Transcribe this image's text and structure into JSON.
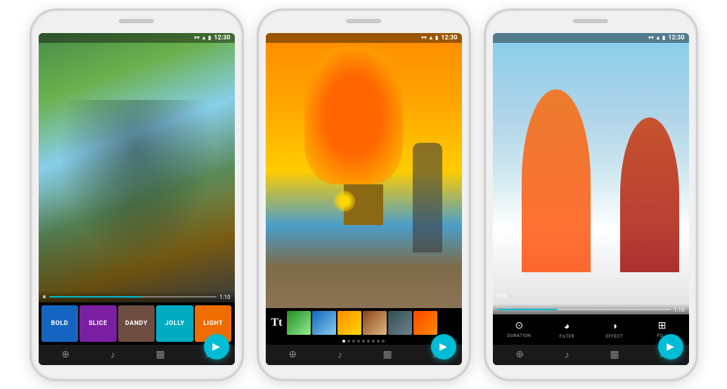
{
  "phones": [
    {
      "id": "phone-1",
      "status_time": "12:30",
      "video_time": "1:10",
      "filters": [
        {
          "id": "bold",
          "label": "BOLD",
          "class": "filter-bold"
        },
        {
          "id": "slice",
          "label": "SLICE",
          "class": "filter-slice"
        },
        {
          "id": "dandy",
          "label": "Dandy",
          "class": "filter-dandy"
        },
        {
          "id": "jolly",
          "label": "Jolly",
          "class": "filter-jolly"
        },
        {
          "id": "light",
          "label": "LIGHT",
          "class": "filter-light"
        }
      ],
      "toolbar_icons": [
        "⊕",
        "♪",
        "▦",
        "≡"
      ],
      "bg_type": "skate",
      "play_icon": "⏸"
    },
    {
      "id": "phone-2",
      "status_time": "12:30",
      "bg_type": "balloon",
      "toolbar_icons": [
        "⊕",
        "♪",
        "▦",
        "≡"
      ],
      "text_tool_icon": "Tt"
    },
    {
      "id": "phone-3",
      "status_time": "12:30",
      "video_time_start": "0:36",
      "video_time_end": "1:10",
      "bg_type": "snow",
      "effects": [
        {
          "id": "duration",
          "label": "DURATION",
          "icon": "⊙"
        },
        {
          "id": "filter",
          "label": "FILTER",
          "icon": "◕"
        },
        {
          "id": "effect",
          "label": "EFFECT",
          "icon": "◑"
        },
        {
          "id": "more",
          "label": "FO...",
          "icon": "⊞"
        }
      ],
      "toolbar_icons": [
        "⊕",
        "♪",
        "▦",
        "≡"
      ]
    }
  ]
}
